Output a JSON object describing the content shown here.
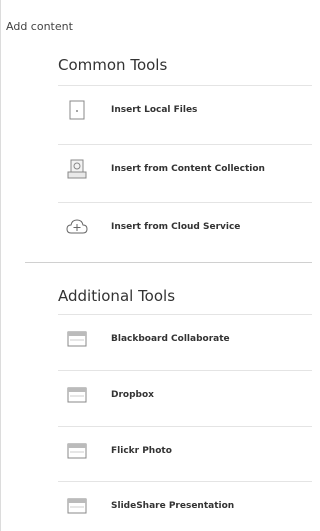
{
  "panel": {
    "title": "Add content"
  },
  "common_tools": {
    "heading": "Common Tools",
    "items": [
      {
        "label": "Insert Local Files",
        "icon": "file-icon"
      },
      {
        "label": "Insert from Content Collection",
        "icon": "content-collection-icon"
      },
      {
        "label": "Insert from Cloud Service",
        "icon": "cloud-add-icon"
      }
    ]
  },
  "additional_tools": {
    "heading": "Additional Tools",
    "items": [
      {
        "label": "Blackboard Collaborate",
        "icon": "tool-window-icon"
      },
      {
        "label": "Dropbox",
        "icon": "tool-window-icon"
      },
      {
        "label": "Flickr Photo",
        "icon": "tool-window-icon"
      },
      {
        "label": "SlideShare Presentation",
        "icon": "tool-window-icon"
      }
    ]
  }
}
